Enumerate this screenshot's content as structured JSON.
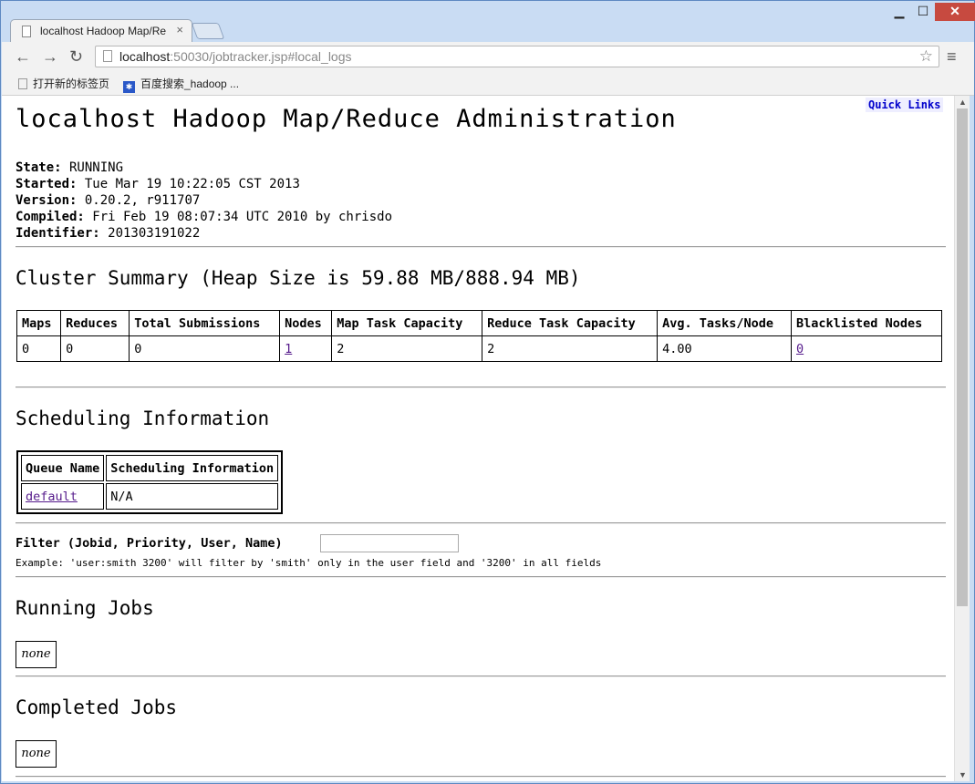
{
  "browser": {
    "tab_title": "localhost Hadoop Map/Re",
    "url_host": "localhost",
    "url_rest": ":50030/jobtracker.jsp#local_logs",
    "bookmarks": [
      "打开新的标签页",
      "百度搜索_hadoop ..."
    ]
  },
  "page": {
    "quick_links": "Quick Links",
    "title": "localhost Hadoop Map/Reduce Administration",
    "info": [
      {
        "label": "State:",
        "value": " RUNNING"
      },
      {
        "label": "Started:",
        "value": " Tue Mar 19 10:22:05 CST 2013"
      },
      {
        "label": "Version:",
        "value": " 0.20.2, r911707"
      },
      {
        "label": "Compiled:",
        "value": " Fri Feb 19 08:07:34 UTC 2010 by chrisdo"
      },
      {
        "label": "Identifier:",
        "value": " 201303191022"
      }
    ],
    "cluster_summary": {
      "heading": "Cluster Summary (Heap Size is 59.88 MB/888.94 MB)",
      "headers": [
        "Maps",
        "Reduces",
        "Total Submissions",
        "Nodes",
        "Map Task Capacity",
        "Reduce Task Capacity",
        "Avg. Tasks/Node",
        "Blacklisted Nodes"
      ],
      "values": [
        "0",
        "0",
        "0",
        "1",
        "2",
        "2",
        "4.00",
        "0"
      ]
    },
    "scheduling": {
      "heading": "Scheduling Information",
      "headers": [
        "Queue Name",
        "Scheduling Information"
      ],
      "queue_name": "default",
      "queue_info": "N/A"
    },
    "filter": {
      "label": "Filter (Jobid, Priority, User, Name)",
      "value": "",
      "example": "Example: 'user:smith 3200' will filter by 'smith' only in the user field and '3200' in all fields"
    },
    "running_jobs": {
      "heading": "Running Jobs",
      "content": "none"
    },
    "completed_jobs": {
      "heading": "Completed Jobs",
      "content": "none"
    }
  }
}
